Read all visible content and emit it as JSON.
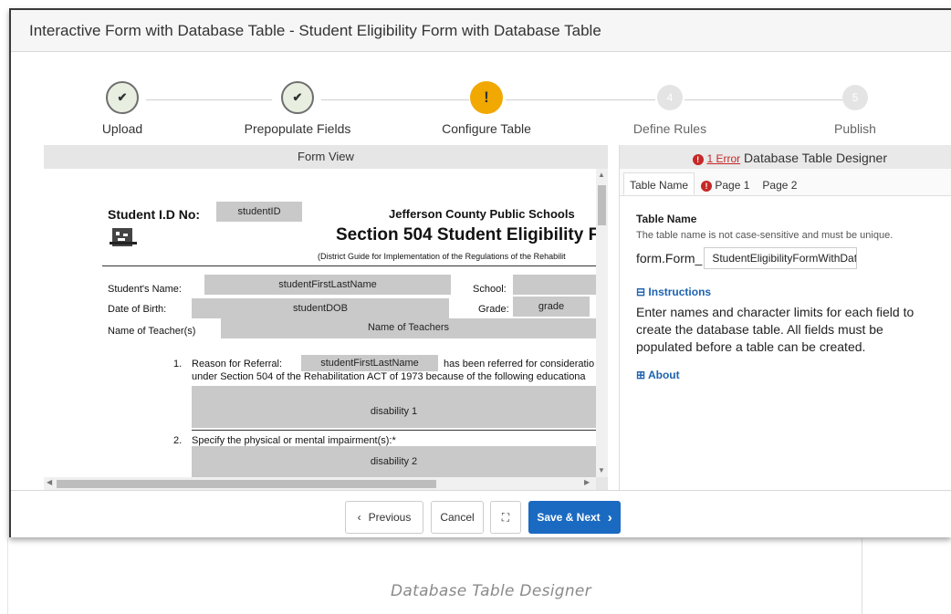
{
  "modal": {
    "title": "Interactive Form with Database Table - Student Eligibility Form with Database Table"
  },
  "stepper": {
    "steps": [
      {
        "label": "Upload",
        "status": "complete",
        "icon": "check-icon"
      },
      {
        "label": "Prepopulate Fields",
        "status": "complete",
        "icon": "check-icon"
      },
      {
        "label": "Configure Table",
        "status": "warning",
        "icon": "!"
      },
      {
        "label": "Define Rules",
        "status": "pending",
        "number": "4"
      },
      {
        "label": "Publish",
        "status": "pending",
        "number": "5"
      }
    ]
  },
  "form_view": {
    "title": "Form View",
    "doc": {
      "student_id_label": "Student I.D No:",
      "student_id_field": "studentID",
      "school_name": "Jefferson County Public Schools",
      "doc_title": "Section 504 Student Eligibility F",
      "subtitle": "(District Guide for Implementation of the Regulations of the Rehabilit",
      "students_name_label": "Student's Name:",
      "students_name_field": "studentFirstLastName",
      "school_label": "School:",
      "dob_label": "Date of Birth:",
      "dob_field": "studentDOB",
      "grade_label": "Grade:",
      "grade_field": "grade",
      "teacher_label": "Name of Teacher(s)",
      "teacher_field": "Name of Teachers",
      "item1_num": "1.",
      "item1_label": "Reason for Referral:",
      "item1_field": "studentFirstLastName",
      "item1_text": "has been referred for consideratio",
      "item1_text2": "under Section 504 of the Rehabilitation ACT of 1973 because of the following educationa",
      "disability1": "disability 1",
      "item2_num": "2.",
      "item2_text": "Specify the physical or mental impairment(s):*",
      "disability2": "disability 2"
    }
  },
  "designer": {
    "error_count_link": "1 Error",
    "title": "Database Table Designer",
    "tabs": [
      {
        "label": "Table Name",
        "active": true,
        "error": false
      },
      {
        "label": "Page 1",
        "active": false,
        "error": true
      },
      {
        "label": "Page 2",
        "active": false,
        "error": false
      }
    ],
    "table_name_heading": "Table Name",
    "table_name_hint": "The table name is not case-sensitive and must be unique.",
    "table_name_prefix": "form.Form_",
    "table_name_value": "StudentEligibilityFormWithDatabaseTable",
    "instructions_toggle": "Instructions",
    "instructions_text": "Enter names and character limits for each field to create the database table. All fields must be populated before a table can be created.",
    "about_toggle": "About"
  },
  "footer": {
    "previous_label": "Previous",
    "cancel_label": "Cancel",
    "save_next_label": "Save & Next"
  },
  "caption": "Database Table Designer",
  "colors": {
    "primary": "#1a6ac2",
    "warning": "#f1a800",
    "error": "#c62828"
  }
}
